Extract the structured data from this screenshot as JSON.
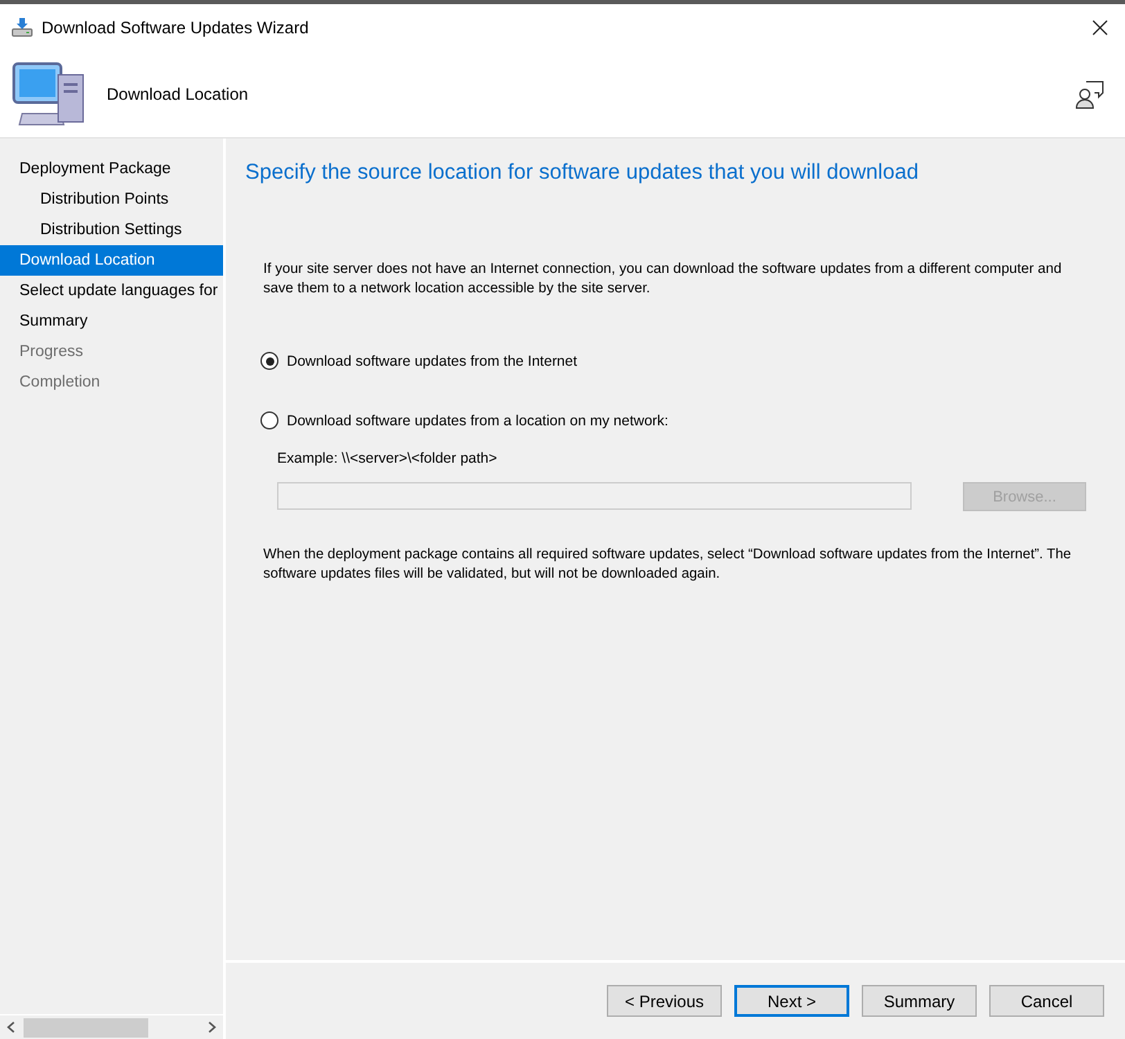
{
  "window": {
    "title": "Download Software Updates Wizard"
  },
  "header": {
    "title": "Download Location"
  },
  "sidebar": {
    "items": [
      {
        "label": "Deployment Package",
        "selected": false,
        "disabled": false,
        "children": [
          {
            "label": "Distribution Points",
            "selected": false,
            "disabled": false
          },
          {
            "label": "Distribution Settings",
            "selected": false,
            "disabled": false
          }
        ]
      },
      {
        "label": "Download Location",
        "selected": true,
        "disabled": false
      },
      {
        "label": "Select update languages for",
        "selected": false,
        "disabled": false
      },
      {
        "label": "Summary",
        "selected": false,
        "disabled": false
      },
      {
        "label": "Progress",
        "selected": false,
        "disabled": true
      },
      {
        "label": "Completion",
        "selected": false,
        "disabled": true
      }
    ]
  },
  "page": {
    "heading": "Specify the source location for software updates that you will download",
    "intro": "If your site server does not have an Internet connection, you can download the software updates from a different computer and save them to a network location accessible by the site server.",
    "options": [
      {
        "label": "Download software updates from the Internet",
        "selected": true
      },
      {
        "label": "Download software updates from a location on my network:",
        "selected": false
      }
    ],
    "example": "Example: \\\\<server>\\<folder path>",
    "path_field": {
      "disabled": true
    },
    "browse": {
      "label": "Browse...",
      "disabled": true
    },
    "note": "When the deployment package contains all required software updates, select “Download  software updates from the Internet”. The software updates files will be validated, but will not be downloaded again."
  },
  "buttons": [
    {
      "label": "< Previous",
      "default": false
    },
    {
      "label": "Next >",
      "default": true
    },
    {
      "label": "Summary",
      "default": false
    },
    {
      "label": "Cancel",
      "default": false
    }
  ]
}
